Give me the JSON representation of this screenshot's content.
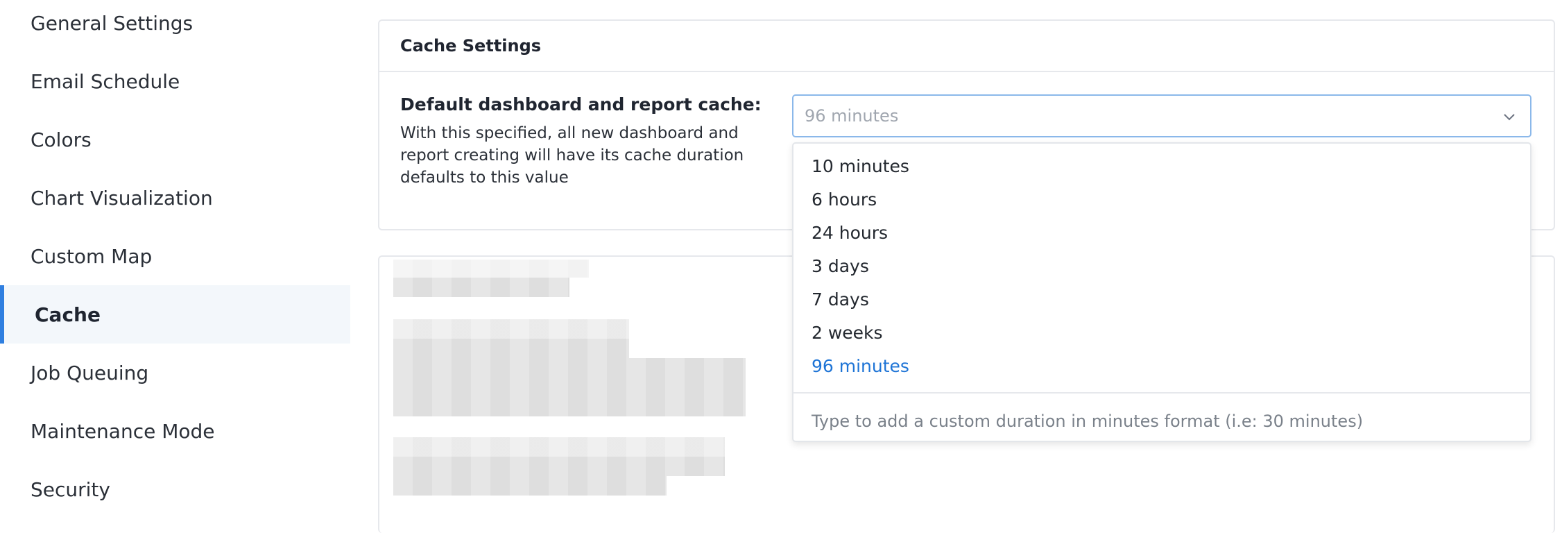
{
  "sidebar": {
    "items": [
      {
        "label": "General Settings"
      },
      {
        "label": "Email Schedule"
      },
      {
        "label": "Colors"
      },
      {
        "label": "Chart Visualization"
      },
      {
        "label": "Custom Map"
      },
      {
        "label": "Cache",
        "active": true
      },
      {
        "label": "Job Queuing"
      },
      {
        "label": "Maintenance Mode"
      },
      {
        "label": "Security"
      }
    ]
  },
  "cache_card": {
    "title": "Cache Settings",
    "setting_label": "Default dashboard and report cache:",
    "setting_description": "With this specified, all new dashboard and report creating will have its cache duration defaults to this value"
  },
  "select": {
    "value": "96 minutes",
    "icon": "chevron-down-icon"
  },
  "dropdown": {
    "options": [
      {
        "label": "10 minutes"
      },
      {
        "label": "6 hours"
      },
      {
        "label": "24 hours"
      },
      {
        "label": "3 days"
      },
      {
        "label": "7 days"
      },
      {
        "label": "2 weeks"
      },
      {
        "label": "96 minutes",
        "selected": true
      }
    ],
    "hint": "Type to add a custom duration in minutes format (i.e: 30 minutes)"
  },
  "colors": {
    "accent": "#2f7fe0",
    "selected_option": "#1e74d6",
    "active_bg": "#f3f7fb"
  }
}
